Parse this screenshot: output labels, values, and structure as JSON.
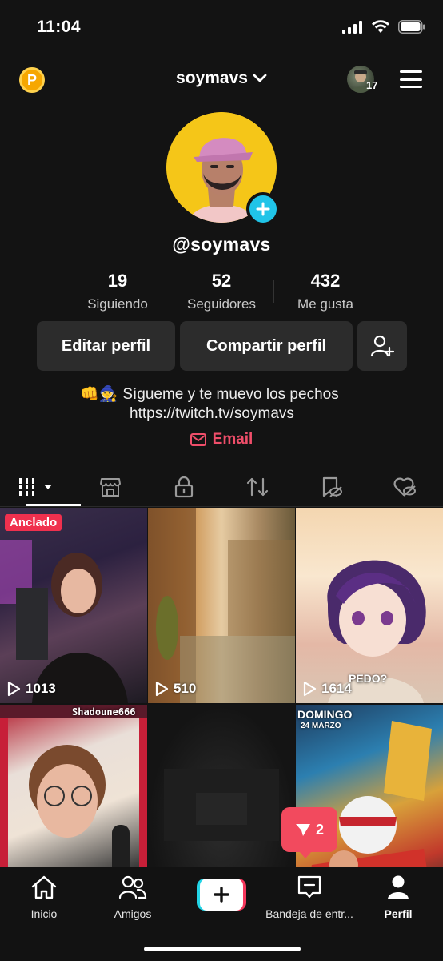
{
  "status_bar": {
    "time": "11:04",
    "icons": [
      "signal-icon",
      "wifi-icon",
      "battery-icon"
    ]
  },
  "header": {
    "coin_label": "P",
    "username": "soymavs",
    "friends_badge": "17",
    "menu_icon": "hamburger-menu-icon"
  },
  "profile": {
    "handle": "@soymavs",
    "stats": [
      {
        "value": "19",
        "label": "Siguiendo"
      },
      {
        "value": "52",
        "label": "Seguidores"
      },
      {
        "value": "432",
        "label": "Me gusta"
      }
    ],
    "buttons": {
      "edit": "Editar perfil",
      "share": "Compartir perfil",
      "add_friend_icon": "add-friend-icon"
    },
    "bio_emoji": "👊🧙",
    "bio_line1": "Sígueme y te muevo los pechos",
    "bio_line2": "https://twitch.tv/soymavs",
    "email_label": "Email"
  },
  "tabs": [
    {
      "icon": "videos-grid-icon",
      "active": true
    },
    {
      "icon": "shop-icon",
      "active": false
    },
    {
      "icon": "private-lock-icon",
      "active": false
    },
    {
      "icon": "reposts-icon",
      "active": false
    },
    {
      "icon": "favorites-hidden-icon",
      "active": false
    },
    {
      "icon": "liked-hidden-icon",
      "active": false
    }
  ],
  "videos": [
    {
      "pinned_label": "Anclado",
      "views": "1013"
    },
    {
      "views": "510"
    },
    {
      "views": "1614",
      "overlay": "PEDO?"
    },
    {
      "overlay": "Shadoune666"
    },
    {},
    {
      "overlay": "DOMINGO",
      "overlay2": "24 MARZO"
    }
  ],
  "inbox_bubble_count": "2",
  "bottom_nav": {
    "home": "Inicio",
    "friends": "Amigos",
    "inbox": "Bandeja de entr...",
    "profile": "Perfil"
  },
  "colors": {
    "background": "#131313",
    "accent_pink": "#f24a5e",
    "accent_cyan": "#22d4e6",
    "email_red": "#f04e6a",
    "avatar_yellow": "#f5c618"
  }
}
